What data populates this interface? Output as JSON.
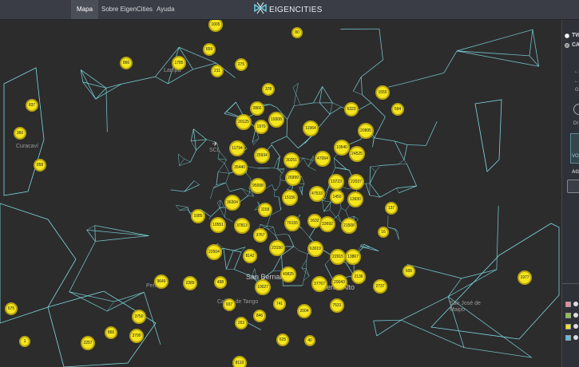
{
  "nav": {
    "items": [
      "Mapa",
      "Sobre EigenCities",
      "Ayuda"
    ],
    "brand_bold": "EIGEN",
    "brand_thin": "CITIES"
  },
  "map": {
    "places": [
      {
        "name": "Lampa",
        "big": false
      },
      {
        "name": "Curacaví",
        "big": false
      },
      {
        "name": "SCL",
        "big": false
      },
      {
        "name": "San Bernardo",
        "big": true
      },
      {
        "name": "Puente Alto",
        "big": true
      },
      {
        "name": "Peñaflor",
        "big": false
      },
      {
        "name": "Calera de Tango",
        "big": false
      },
      {
        "name": "San José de Maipo",
        "big": false
      }
    ],
    "clusters": [
      "1005",
      "80",
      "659",
      "1785",
      "211",
      "275",
      "866",
      "378",
      "2866",
      "20125",
      "19308",
      "1970",
      "6323",
      "1555",
      "594",
      "837",
      "11964",
      "20895",
      "360",
      "11794",
      "25934",
      "30251",
      "47064",
      "10540",
      "24525",
      "858",
      "35440",
      "26999",
      "95008",
      "10723",
      "22037",
      "1085",
      "36304",
      "47533",
      "1450",
      "13930",
      "137",
      "15156",
      "1158",
      "76155",
      "1632",
      "33692",
      "21508",
      "10551",
      "37813",
      "3767",
      "16",
      "22504",
      "8142",
      "23150",
      "63019",
      "22915",
      "13867",
      "605",
      "9649",
      "2389",
      "498",
      "10027",
      "49825",
      "37767",
      "29043",
      "2136",
      "2737",
      "1977",
      "675",
      "937",
      "741",
      "2004",
      "7531",
      "3750",
      "263",
      "846",
      "866",
      "2257",
      "3799",
      "1",
      "625",
      "40",
      "8110"
    ]
  },
  "panel": {
    "options": [
      {
        "label": "TW",
        "selected": false
      },
      {
        "label": "CA",
        "selected": true
      }
    ],
    "labels": [
      "G",
      "DI",
      "VO",
      "AG"
    ],
    "legend_colors": [
      "#e88a9a",
      "#8dc63f",
      "#f4e51c",
      "#5bc0de"
    ]
  }
}
